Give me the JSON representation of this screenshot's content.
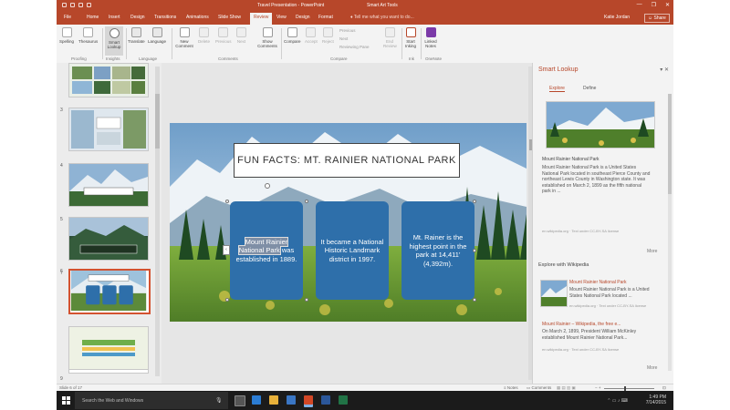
{
  "window": {
    "title": "Travel Presentation - PowerPoint",
    "context_tab": "Smart Art Tools",
    "controls": [
      "—",
      "❐",
      "✕"
    ]
  },
  "tabs": [
    "File",
    "Home",
    "Insert",
    "Design",
    "Transitions",
    "Animations",
    "Slide Show",
    "Review",
    "View",
    "Design",
    "Format"
  ],
  "active_tab": "Review",
  "tell_me": "Tell me what you want to do...",
  "user": "Katie Jordan",
  "share": "Share",
  "ribbon": {
    "buttons": {
      "spelling": "Spelling",
      "thesaurus": "Thesaurus",
      "smart_lookup": "Smart Lookup",
      "translate": "Translate",
      "language": "Language",
      "new_comment": "New Comment",
      "delete": "Delete",
      "previous": "Previous",
      "next": "Next",
      "show_comments": "Show Comments",
      "compare": "Compare",
      "accept": "Accept",
      "reject": "Reject",
      "prev_small": "Previous",
      "next_small": "Next",
      "reviewing_pane": "Reviewing Pane",
      "end_review": "End Review",
      "start_inking": "Start Inking",
      "linked_notes": "Linked Notes"
    },
    "groups": {
      "proofing": "Proofing",
      "insights": "Insights",
      "language": "Language",
      "comments": "Comments",
      "compare": "Compare",
      "ink": "Ink",
      "onenote": "OneNote"
    }
  },
  "thumbnails": {
    "numbers": [
      "3",
      "4",
      "5",
      "6",
      "7",
      "8"
    ]
  },
  "slide": {
    "title": "FUN FACTS: MT. RAINIER NATIONAL PARK",
    "facts": [
      {
        "pre": "Mount Rainier National Park",
        "rest": " was established in 1889."
      },
      {
        "text": "It became a National Historic Landmark district in 1997."
      },
      {
        "text": "Mt. Rainer is the highest point in the park at 14,411' (4,392m)."
      }
    ]
  },
  "smart_lookup": {
    "title": "Smart Lookup",
    "controls": "▾ ✕",
    "tabs": [
      "Explore",
      "Define"
    ],
    "card_title": "Mount Rainier National Park",
    "card_body": "Mount Rainier National Park is a United States National Park located in southeast Pierce County and northeast Lewis County in Washington state. It was established on March 2, 1899 as the fifth national park in ...",
    "card_source": "en.wikipedia.org · Text under CC-BY-SA license",
    "more": "More",
    "section": "Explore with Wikipedia",
    "results": [
      {
        "title": "Mount Rainier National Park",
        "body": "Mount Rainier National Park is a United States National Park located ...",
        "source": "en.wikipedia.org · Text under CC-BY-SA license"
      },
      {
        "title": "Mount Rainier – Wikipedia, the free e...",
        "body": "On March 2, 1899, President William McKinley established Mount Rainier National Park...",
        "source": "en.wikipedia.org · Text under CC-BY-SA license"
      }
    ],
    "more2": "More"
  },
  "status": {
    "slide": "Slide 6 of 17",
    "notes": "Notes",
    "comments": "Comments",
    "zoom_icons": "− +"
  },
  "taskbar": {
    "search": "Search the Web and Windows",
    "time": "1:49 PM",
    "date": "7/14/2015"
  },
  "colors": {
    "accent": "#b7472a",
    "fact_box": "#2e6faa",
    "taskbar": "#1b1b1b"
  }
}
